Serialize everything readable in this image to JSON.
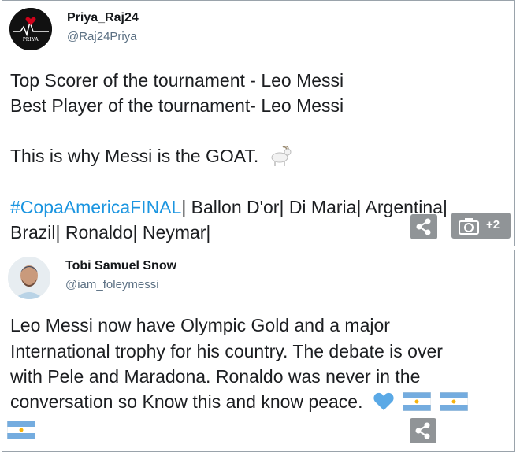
{
  "tweet1": {
    "display_name": "Priya_Raj24",
    "handle": "@Raj24Priya",
    "avatar_text": "PRIYA",
    "line1": "Top Scorer of the tournament - Leo Messi",
    "line2": "Best Player of the tournament- Leo Messi",
    "line3": "This is why Messi is the GOAT.",
    "hashtag": "#CopaAmericaFINAL",
    "line4_rest": "| Ballon D'or| Di Maria| Argentina|",
    "line5": "Brazil| Ronaldo| Neymar|",
    "goat_icon": "goat-emoji-icon",
    "photo_count": "+2"
  },
  "tweet2": {
    "display_name": "Tobi Samuel Snow",
    "handle": "@iam_foleymessi",
    "line1": "Leo Messi now have Olympic Gold and a major",
    "line2": "International trophy for his country. The debate is over",
    "line3": "with Pele and Maradona.  Ronaldo was never in the",
    "line4": "conversation so Know this and know peace.",
    "heart_color": "#5aa9e6",
    "flag_colors": {
      "blue": "#74acdf",
      "white": "#ffffff",
      "sun": "#f6b40e"
    }
  }
}
